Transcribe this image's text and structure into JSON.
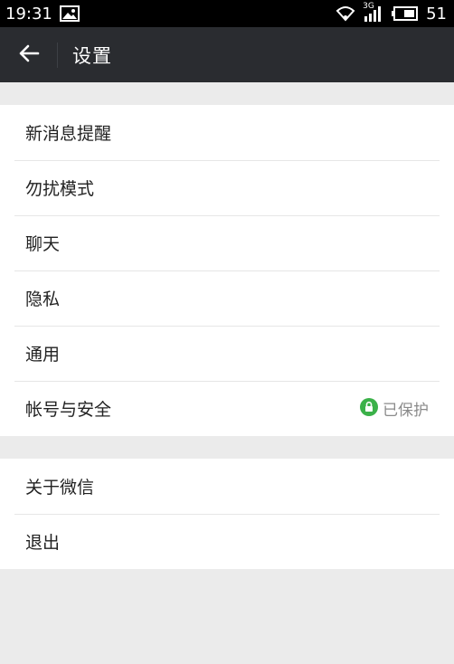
{
  "status_bar": {
    "time": "19:31",
    "network": "3G",
    "battery": "51"
  },
  "toolbar": {
    "title": "设置"
  },
  "groups": [
    {
      "items": [
        {
          "label": "新消息提醒"
        },
        {
          "label": "勿扰模式"
        },
        {
          "label": "聊天"
        },
        {
          "label": "隐私"
        },
        {
          "label": "通用"
        },
        {
          "label": "帐号与安全",
          "extra": "已保护"
        }
      ]
    },
    {
      "items": [
        {
          "label": "关于微信"
        },
        {
          "label": "退出"
        }
      ]
    }
  ],
  "colors": {
    "toolbar": "#2a2c30",
    "status_bar": "#000000",
    "background": "#ebebeb",
    "protected_badge": "#3bb149"
  },
  "icons": {
    "back": "back-arrow-icon",
    "protected": "lock-icon",
    "gallery": "image-icon",
    "wifi": "wifi-icon",
    "signal": "signal-icon",
    "battery": "battery-icon"
  }
}
